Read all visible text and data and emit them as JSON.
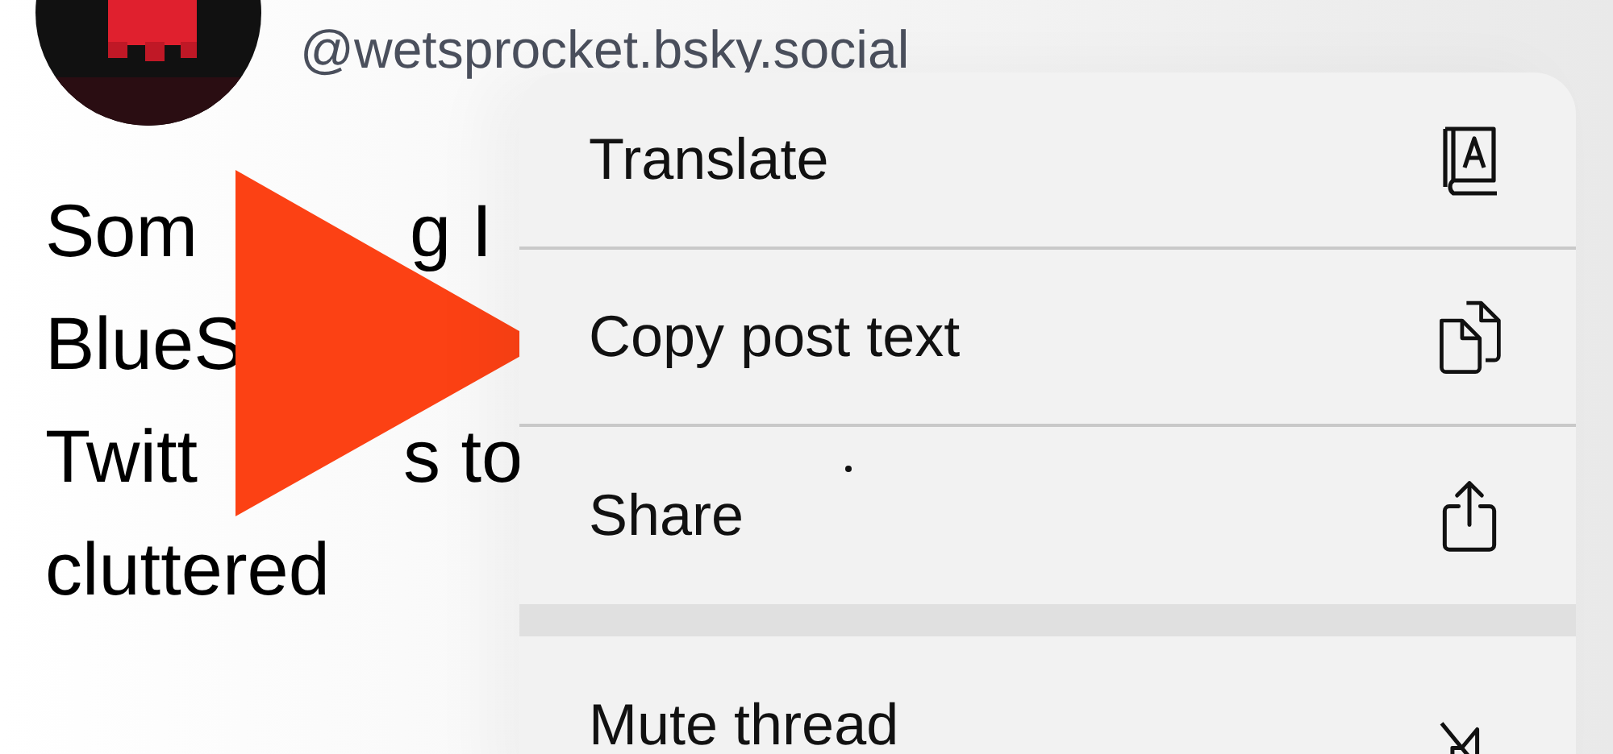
{
  "post": {
    "handle": "@wetsprocket.bsky.social",
    "lines": [
      {
        "left": "Som",
        "right": "g I"
      },
      {
        "left": "BlueS"
      },
      {
        "left": "Twitt",
        "right": "s to"
      },
      {
        "left": "cluttered"
      }
    ]
  },
  "menu": {
    "groups": [
      [
        {
          "label": "Translate"
        },
        {
          "label": "Copy post text"
        },
        {
          "label": "Share"
        }
      ],
      [
        {
          "label": "Mute thread"
        }
      ]
    ]
  }
}
